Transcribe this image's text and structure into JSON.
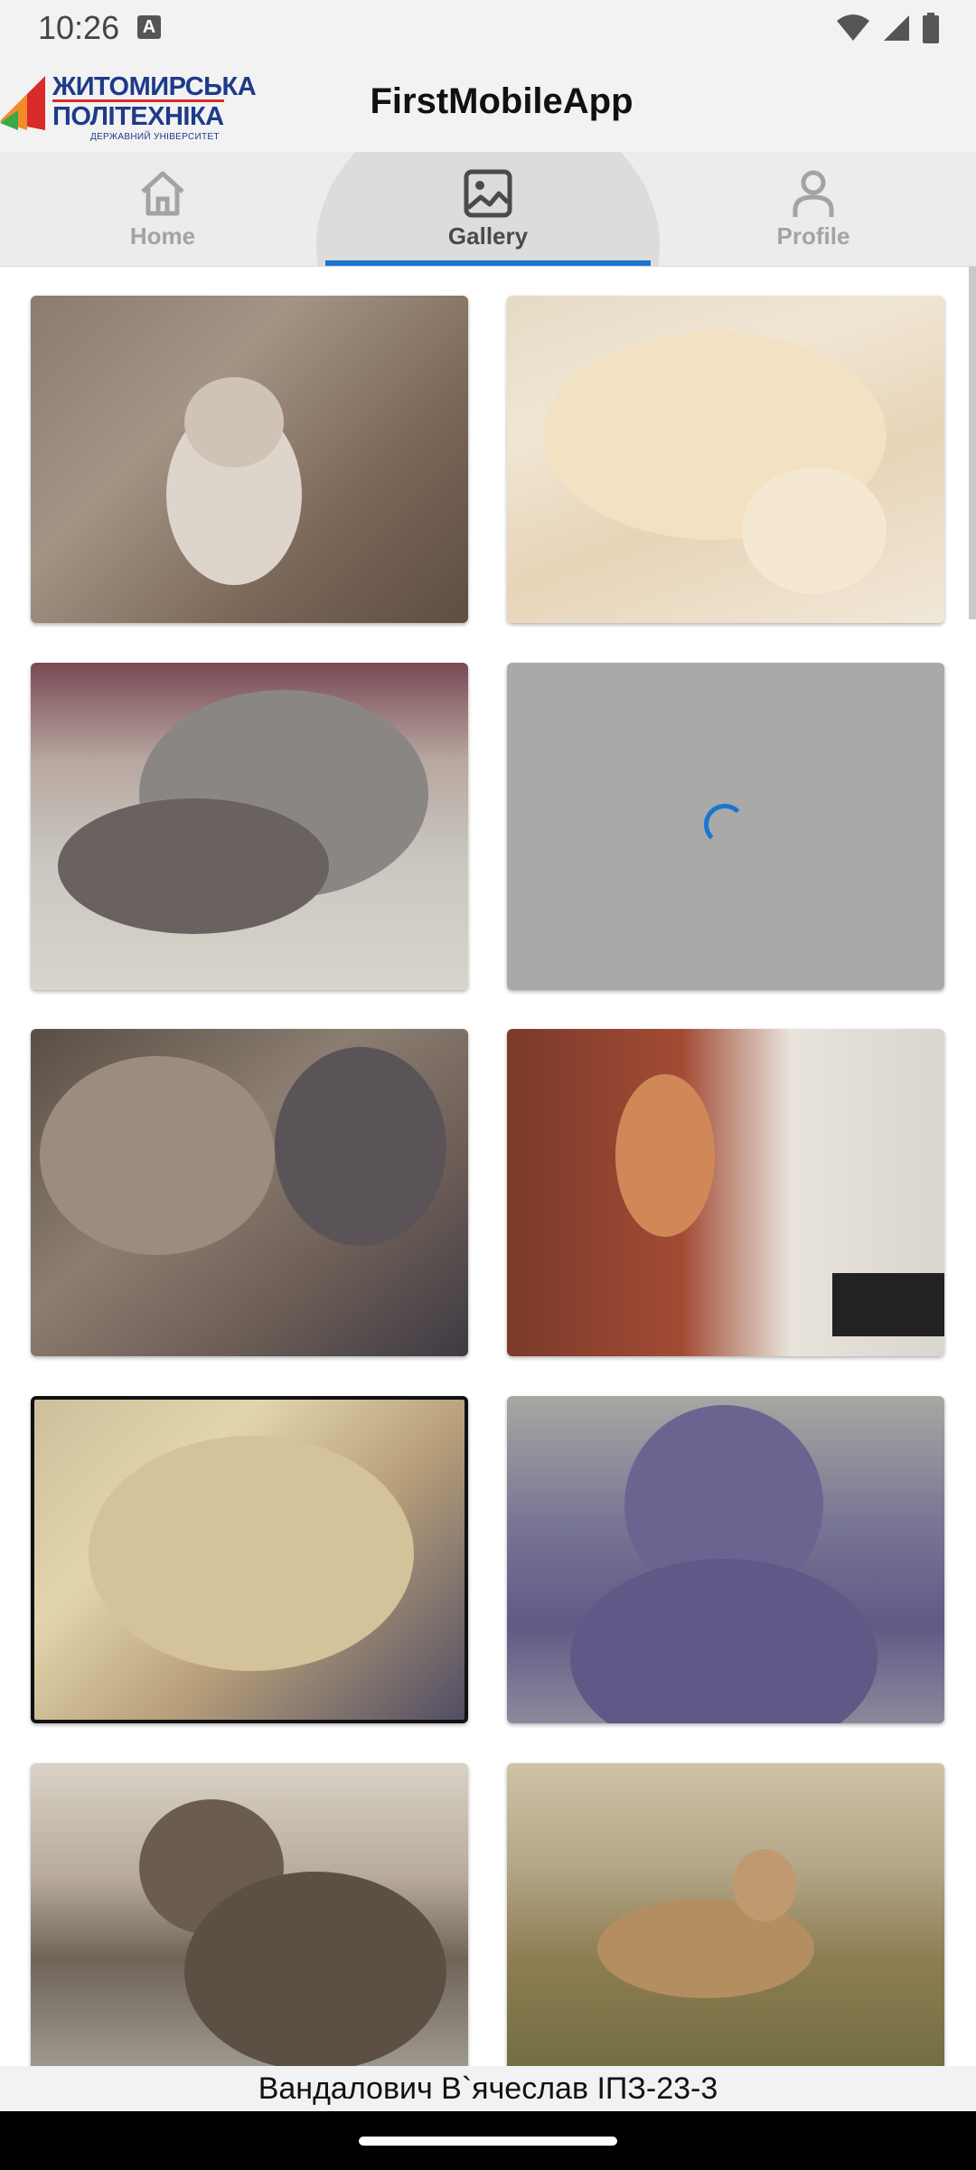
{
  "status_bar": {
    "time": "10:26",
    "notification_icon": "a-icon",
    "icons": [
      "wifi-icon",
      "signal-icon",
      "battery-icon"
    ]
  },
  "app_bar": {
    "logo": {
      "line1": "ЖИТОМИРСЬКА",
      "line2": "ПОЛІТЕХНІКА",
      "line3": "ДЕРЖАВНИЙ УНІВЕРСИТЕТ"
    },
    "title": "FirstMobileApp"
  },
  "tabs": [
    {
      "label": "Home",
      "icon": "home-icon",
      "selected": false
    },
    {
      "label": "Gallery",
      "icon": "image-icon",
      "selected": true
    },
    {
      "label": "Profile",
      "icon": "person-icon",
      "selected": false
    }
  ],
  "gallery": {
    "images": [
      {
        "state": "loaded"
      },
      {
        "state": "loaded"
      },
      {
        "state": "loaded"
      },
      {
        "state": "loading"
      },
      {
        "state": "loaded"
      },
      {
        "state": "loaded"
      },
      {
        "state": "loaded"
      },
      {
        "state": "loaded"
      },
      {
        "state": "loaded"
      },
      {
        "state": "loaded"
      }
    ]
  },
  "footer": {
    "text": "Вандалович В`ячеслав ІПЗ-23-3"
  },
  "colors": {
    "accent": "#1976d2",
    "app_bar_bg": "#f2f2f2",
    "tab_bg": "#ececec",
    "loading_placeholder": "#a9a9a9"
  }
}
